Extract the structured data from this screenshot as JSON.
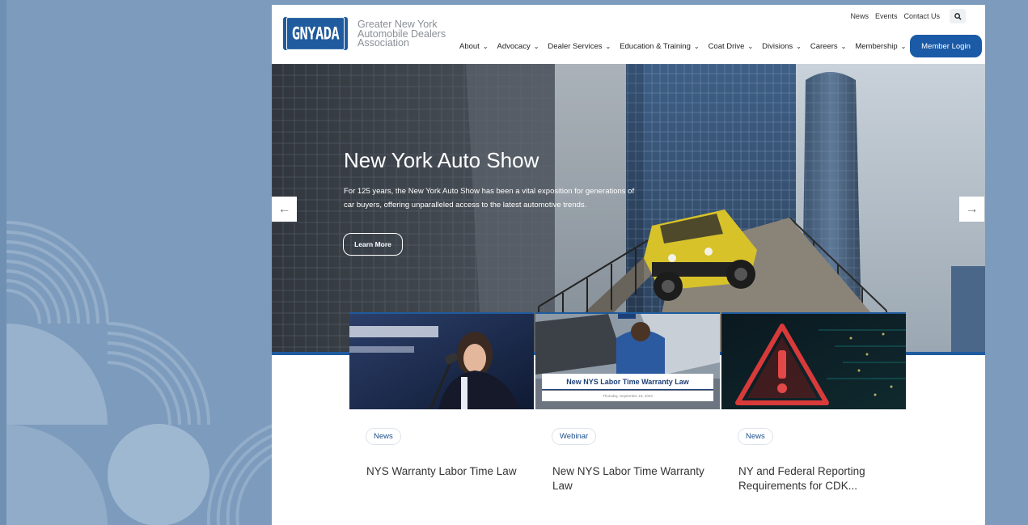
{
  "logo": {
    "badge": "GNYADA",
    "lines": [
      "Greater New York",
      "Automobile Dealers",
      "Association"
    ]
  },
  "utility_nav": [
    "News",
    "Events",
    "Contact Us"
  ],
  "main_nav": [
    {
      "label": "About"
    },
    {
      "label": "Advocacy"
    },
    {
      "label": "Dealer Services"
    },
    {
      "label": "Education & Training"
    },
    {
      "label": "Coat Drive"
    },
    {
      "label": "Divisions"
    },
    {
      "label": "Careers"
    },
    {
      "label": "Membership"
    }
  ],
  "login_label": "Member Login",
  "hero": {
    "title": "New York Auto Show",
    "text": "For 125 years, the New York Auto Show has been a vital exposition for generations of car buyers, offering unparalleled access to the latest automotive trends.",
    "button": "Learn More",
    "prev": "←",
    "next": "→"
  },
  "cards": [
    {
      "tag": "News",
      "title": "NYS Warranty Labor Time Law"
    },
    {
      "tag": "Webinar",
      "title": "New NYS Labor Time Warranty Law",
      "image_banner": "New NYS Labor Time Warranty Law",
      "image_date": "Thursday, September 19, 2024"
    },
    {
      "tag": "News",
      "title": "NY and Federal Reporting Requirements for CDK..."
    }
  ],
  "colors": {
    "background": "#7c9bbd",
    "brand_blue": "#1b5aa6",
    "accent_border": "#1f5b9e"
  }
}
